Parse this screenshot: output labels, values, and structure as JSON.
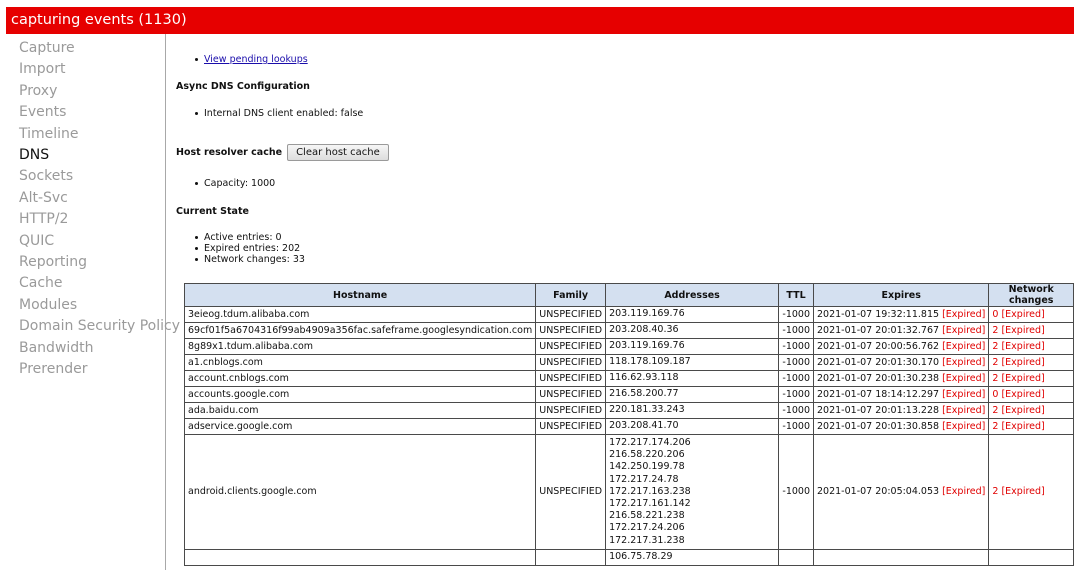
{
  "topbar": {
    "title": "capturing events (1130)"
  },
  "sidebar": {
    "items": [
      {
        "label": "Capture"
      },
      {
        "label": "Import"
      },
      {
        "label": "Proxy"
      },
      {
        "label": "Events"
      },
      {
        "label": "Timeline"
      },
      {
        "label": "DNS"
      },
      {
        "label": "Sockets"
      },
      {
        "label": "Alt-Svc"
      },
      {
        "label": "HTTP/2"
      },
      {
        "label": "QUIC"
      },
      {
        "label": "Reporting"
      },
      {
        "label": "Cache"
      },
      {
        "label": "Modules"
      },
      {
        "label": "Domain Security Policy"
      },
      {
        "label": "Bandwidth"
      },
      {
        "label": "Prerender"
      }
    ],
    "active_index": 5
  },
  "main": {
    "pending_link": "View pending lookups",
    "async_heading": "Async DNS Configuration",
    "internal_dns": "Internal DNS client enabled: false",
    "cache_heading": "Host resolver cache",
    "clear_button": "Clear host cache",
    "capacity": "Capacity: 1000",
    "state_heading": "Current State",
    "active_entries": "Active entries: 0",
    "expired_entries": "Expired entries: 202",
    "network_changes": "Network changes: 33"
  },
  "table": {
    "headers": [
      "Hostname",
      "Family",
      "Addresses",
      "TTL",
      "Expires",
      "Network changes"
    ],
    "expired_tag": "[Expired]",
    "rows": [
      {
        "hostname": "3eieog.tdum.alibaba.com",
        "family": "UNSPECIFIED",
        "addresses": [
          "203.119.169.76"
        ],
        "ttl": "-1000",
        "expires": "2021-01-07 19:32:11.815",
        "netchanges": "0"
      },
      {
        "hostname": "69cf01f5a6704316f99ab4909a356fac.safeframe.googlesyndication.com",
        "family": "UNSPECIFIED",
        "addresses": [
          "203.208.40.36"
        ],
        "ttl": "-1000",
        "expires": "2021-01-07 20:01:32.767",
        "netchanges": "2"
      },
      {
        "hostname": "8g89x1.tdum.alibaba.com",
        "family": "UNSPECIFIED",
        "addresses": [
          "203.119.169.76"
        ],
        "ttl": "-1000",
        "expires": "2021-01-07 20:00:56.762",
        "netchanges": "2"
      },
      {
        "hostname": "a1.cnblogs.com",
        "family": "UNSPECIFIED",
        "addresses": [
          "118.178.109.187"
        ],
        "ttl": "-1000",
        "expires": "2021-01-07 20:01:30.170",
        "netchanges": "2"
      },
      {
        "hostname": "account.cnblogs.com",
        "family": "UNSPECIFIED",
        "addresses": [
          "116.62.93.118"
        ],
        "ttl": "-1000",
        "expires": "2021-01-07 20:01:30.238",
        "netchanges": "2"
      },
      {
        "hostname": "accounts.google.com",
        "family": "UNSPECIFIED",
        "addresses": [
          "216.58.200.77"
        ],
        "ttl": "-1000",
        "expires": "2021-01-07 18:14:12.297",
        "netchanges": "0"
      },
      {
        "hostname": "ada.baidu.com",
        "family": "UNSPECIFIED",
        "addresses": [
          "220.181.33.243"
        ],
        "ttl": "-1000",
        "expires": "2021-01-07 20:01:13.228",
        "netchanges": "2"
      },
      {
        "hostname": "adservice.google.com",
        "family": "UNSPECIFIED",
        "addresses": [
          "203.208.41.70"
        ],
        "ttl": "-1000",
        "expires": "2021-01-07 20:01:30.858",
        "netchanges": "2"
      },
      {
        "hostname": "android.clients.google.com",
        "family": "UNSPECIFIED",
        "addresses": [
          "172.217.174.206",
          "216.58.220.206",
          "142.250.199.78",
          "172.217.24.78",
          "172.217.163.238",
          "172.217.161.142",
          "216.58.221.238",
          "172.217.24.206",
          "172.217.31.238"
        ],
        "ttl": "-1000",
        "expires": "2021-01-07 20:05:04.053",
        "netchanges": "2"
      },
      {
        "hostname": "",
        "family": "",
        "addresses": [
          "106.75.78.29"
        ],
        "ttl": "",
        "expires": "",
        "netchanges": ""
      }
    ]
  }
}
